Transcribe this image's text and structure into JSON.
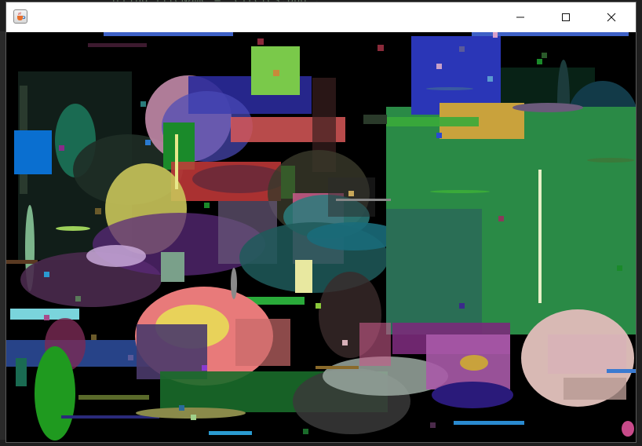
{
  "background_editor": {
    "code_snippet": "String fileName = \"circles.png\";"
  },
  "window": {
    "title": "",
    "controls": {
      "minimize_icon": "minimize-icon",
      "maximize_icon": "maximize-icon",
      "close_icon": "close-icon"
    },
    "app_icon": "java-coffee-cup-icon"
  },
  "canvas": {
    "background": "#000000",
    "description_items": {
      "rectangles": [
        {
          "color": "#2a36b7"
        },
        {
          "color": "#6f3bb9"
        },
        {
          "color": "#7ac94a"
        },
        {
          "color": "#2a8a46"
        },
        {
          "color": "#c9a23c"
        },
        {
          "color": "#0a6fd0"
        }
      ],
      "ellipses": [
        {
          "color": "#e87a7a"
        },
        {
          "color": "#c9c45a"
        },
        {
          "color": "#d8b9b4"
        },
        {
          "color": "#2a7d7d"
        },
        {
          "color": "#1f9a1f"
        }
      ]
    }
  }
}
